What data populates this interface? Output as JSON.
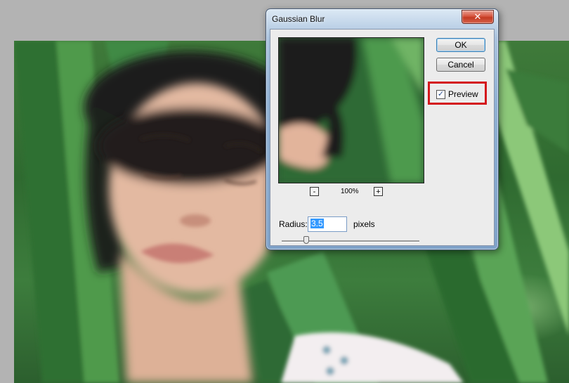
{
  "dialog": {
    "title": "Gaussian Blur",
    "close_glyph": "✕"
  },
  "buttons": {
    "ok_label": "OK",
    "cancel_label": "Cancel"
  },
  "preview_checkbox": {
    "label": "Preview",
    "checked": true,
    "check_glyph": "✓"
  },
  "zoom": {
    "minus_label": "-",
    "plus_label": "+",
    "level": "100%"
  },
  "radius": {
    "label": "Radius:",
    "value": "3.5",
    "unit": "pixels",
    "slider_fraction": 0.18
  },
  "colors": {
    "highlight": "#d4161c",
    "selection": "#3399ff"
  }
}
